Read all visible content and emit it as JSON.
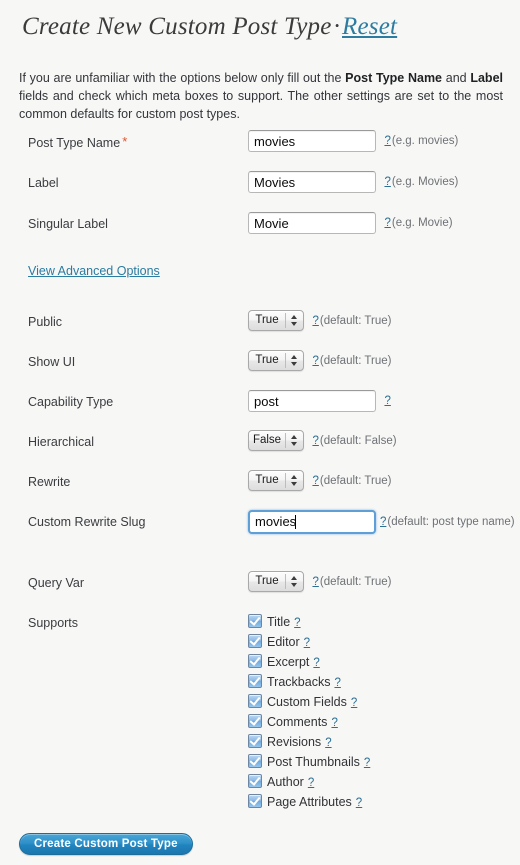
{
  "header": {
    "title": "Create New Custom Post Type",
    "separator": "·",
    "reset_label": "Reset"
  },
  "intro": {
    "part1": "If you are unfamiliar with the options below only fill out the ",
    "bold1": "Post Type Name",
    "part2": " and ",
    "bold2": "Label",
    "part3": " fields and check which meta boxes to support. The other settings are set to the most common defaults for custom post types."
  },
  "advanced_link": {
    "label": "View Advanced Options"
  },
  "help_marker": "?",
  "fields": {
    "post_type_name": {
      "label": "Post Type Name",
      "required_marker": "*",
      "value": "movies",
      "placeholder": "",
      "hint": "(e.g. movies)"
    },
    "label": {
      "label": "Label",
      "value": "Movies",
      "placeholder": "",
      "hint": "(e.g. Movies)"
    },
    "singular_label": {
      "label": "Singular Label",
      "value": "Movie",
      "placeholder": "",
      "hint": "(e.g. Movie)"
    },
    "public": {
      "label": "Public",
      "value": "True",
      "hint": "(default: True)"
    },
    "show_ui": {
      "label": "Show UI",
      "value": "True",
      "hint": "(default: True)"
    },
    "capability_type": {
      "label": "Capability Type",
      "value": "post",
      "placeholder": "",
      "hint": ""
    },
    "hierarchical": {
      "label": "Hierarchical",
      "value": "False",
      "hint": "(default: False)"
    },
    "rewrite": {
      "label": "Rewrite",
      "value": "True",
      "hint": "(default: True)"
    },
    "custom_rewrite_slug": {
      "label": "Custom Rewrite Slug",
      "value": "movies",
      "placeholder": "",
      "hint": "(default: post type name)"
    },
    "query_var": {
      "label": "Query Var",
      "value": "True",
      "hint": "(default: True)"
    },
    "supports": {
      "label": "Supports",
      "items": [
        {
          "label": "Title",
          "checked": true
        },
        {
          "label": "Editor",
          "checked": true
        },
        {
          "label": "Excerpt",
          "checked": true
        },
        {
          "label": "Trackbacks",
          "checked": true
        },
        {
          "label": "Custom Fields",
          "checked": true
        },
        {
          "label": "Comments",
          "checked": true
        },
        {
          "label": "Revisions",
          "checked": true
        },
        {
          "label": "Post Thumbnails",
          "checked": true
        },
        {
          "label": "Author",
          "checked": true
        },
        {
          "label": "Page Attributes",
          "checked": true
        }
      ]
    }
  },
  "submit": {
    "label": "Create Custom Post Type"
  },
  "colors": {
    "link": "#2c7ba0",
    "required": "#e8502a",
    "focus_ring": "#5d9fd6",
    "button_top": "#49a5d6",
    "button_bottom": "#1b76ae",
    "background": "#f7f7f6"
  }
}
